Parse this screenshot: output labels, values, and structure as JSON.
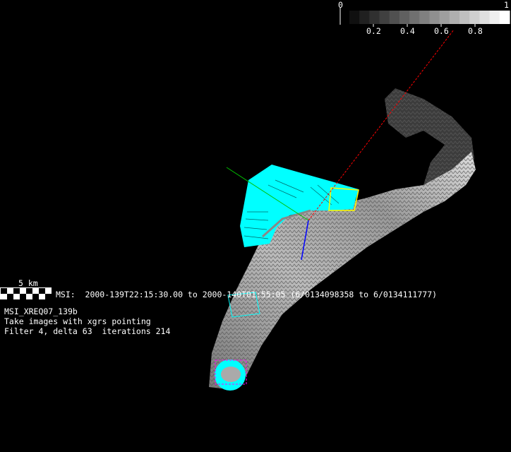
{
  "colorbar": {
    "min_label": "0",
    "max_label": "1",
    "tick_labels": [
      "0.2",
      "0.4",
      "0.6",
      "0.8"
    ],
    "steps": 16
  },
  "scale_bar": {
    "label": "5 km"
  },
  "msi_line": "MSI:  2000-139T22:15:30.00 to 2000-140T01:55:05 (6/0134098358 to 6/0134111777)",
  "info": {
    "sequence": "MSI_XREQ07_139b",
    "description": "Take images with xgrs pointing",
    "params": "Filter 4, delta 63  iterations 214"
  },
  "colors": {
    "footprint": "#00ffff",
    "selected_footprint": "#ffff00",
    "x_axis": "#ff0000",
    "y_axis": "#00c000",
    "z_axis": "#0000ff",
    "target_box": "#ff00ff"
  }
}
